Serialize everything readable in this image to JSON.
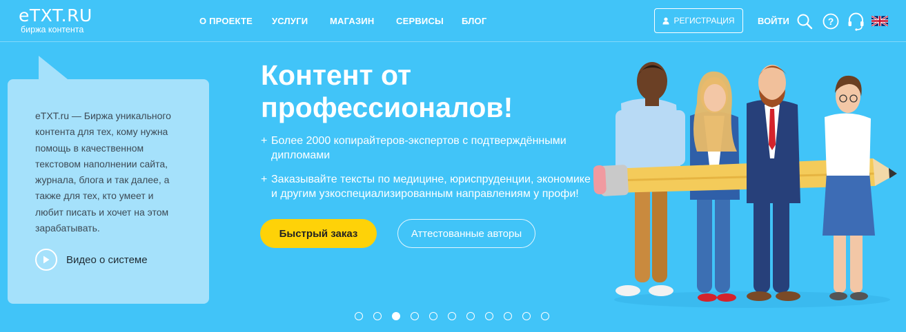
{
  "header": {
    "logo_main": "eTXT.RU",
    "logo_sub": "биржа контента",
    "nav": [
      "О ПРОЕКТЕ",
      "УСЛУГИ",
      "МАГАЗИН",
      "СЕРВИСЫ",
      "БЛОГ"
    ],
    "register_label": "РЕГИСТРАЦИЯ",
    "login_label": "ВОЙТИ",
    "icons": [
      "search-icon",
      "help-icon",
      "support-headset-icon",
      "uk-flag-icon"
    ]
  },
  "info": {
    "text": "eTXT.ru — Биржа уникального контента для тех, кому нужна помощь в качественном текстовом наполнении сайта, журнала, блога и так далее, а также для тех, кто умеет и любит писать и хочет на этом зарабатывать.",
    "video_label": "Видео о системе"
  },
  "hero": {
    "title_line1": "Контент от",
    "title_line2": "профессионалов!",
    "bullet1_line1": "Более 2000 копирайтеров-экспертов с подтверждёнными",
    "bullet1_line2": "дипломами",
    "bullet2_line1": "Заказывайте тексты по медицине, юриспруденции, экономике",
    "bullet2_line2": "и другим узкоспециализированным направлениям у профи!",
    "plus": "+",
    "primary_button": "Быстрый заказ",
    "secondary_button": "Аттестованные авторы"
  },
  "carousel": {
    "slide_count": 11,
    "active_index": 2
  },
  "colors": {
    "background": "#41c4f8",
    "bubble": "#a5e1fb",
    "primary_button": "#fed208",
    "text_white": "#ffffff"
  }
}
